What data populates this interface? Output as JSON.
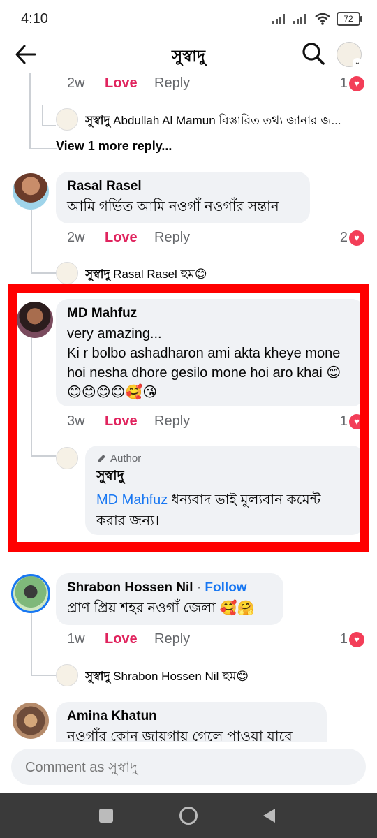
{
  "status_bar": {
    "time": "4:10",
    "battery": "72"
  },
  "header": {
    "title": "সুস্বাদু",
    "back_icon": "arrow-left-icon",
    "search_icon": "search-icon"
  },
  "comments": {
    "c0": {
      "ago": "2w",
      "love": "Love",
      "reply": "Reply",
      "count": "1",
      "sub_reply": {
        "name": "সুস্বাদু",
        "text": "Abdullah Al Mamun বিস্তারিত তথ্য জানার জ..."
      },
      "view_more": "View 1 more reply..."
    },
    "c1": {
      "name": "Rasal Rasel",
      "text": "আমি গর্ভিত আমি নওগাঁ নওগাঁর সন্তান",
      "ago": "2w",
      "love": "Love",
      "reply": "Reply",
      "count": "2",
      "sub_reply": {
        "name": "সুস্বাদু",
        "text": "Rasal Rasel হুম😊"
      }
    },
    "c2": {
      "name": "MD Mahfuz",
      "text": "very amazing...\nKi r bolbo ashadharon ami akta kheye mone hoi nesha dhore gesilo mone hoi aro khai 😊😊😊😊😊🥰😘",
      "ago": "3w",
      "love": "Love",
      "reply": "Reply",
      "count": "1",
      "author_reply": {
        "tag": "Author",
        "name": "সুস্বাদু",
        "mention": "MD Mahfuz",
        "text": " ধন্যবাদ ভাই মুল্যবান কমেন্ট করার জন্য।"
      }
    },
    "c3": {
      "name": "Shrabon Hossen Nil",
      "follow": "Follow",
      "text": "প্রাণ প্রিয় শহর নওগাঁ জেলা 🥰🤗",
      "ago": "1w",
      "love": "Love",
      "reply": "Reply",
      "count": "1",
      "sub_reply": {
        "name": "সুস্বাদু",
        "text": "Shrabon Hossen Nil হুম😊"
      }
    },
    "c4": {
      "name": "Amina Khatun",
      "text": "নওগাঁর কোন জায়গায় গেলে পাওয়া যাবে"
    }
  },
  "composer": {
    "placeholder": "Comment as সুস্বাদু"
  },
  "colors": {
    "love": "#e0245e",
    "highlight": "#ff0000",
    "link": "#1877f2",
    "bubble": "#f0f2f5"
  }
}
